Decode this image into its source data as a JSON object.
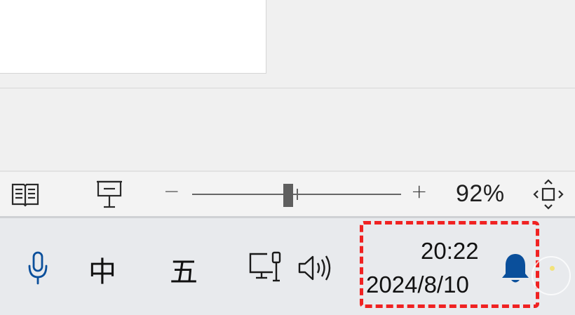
{
  "status_bar": {
    "zoom": {
      "minus_label": "−",
      "plus_label": "+",
      "level_text": "92%",
      "level_value": 92
    },
    "icons": {
      "read_mode": "book-open-icon",
      "presentation": "presentation-icon",
      "fit_page": "fit-to-window-icon"
    }
  },
  "taskbar": {
    "mic_icon": "microphone-icon",
    "ime_mode_label": "中",
    "ime_input_label": "五",
    "network_icon": "network-icon",
    "volume_icon": "volume-icon",
    "clock": {
      "time": "20:22",
      "date": "2024/8/10"
    },
    "notification_icon": "bell-icon",
    "colors": {
      "accent_blue": "#0a4f9b",
      "highlight_red": "#f02222"
    }
  }
}
